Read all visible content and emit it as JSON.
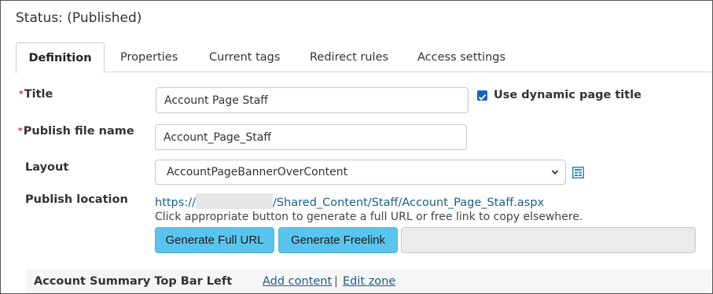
{
  "status": "Status: (Published)",
  "tabs": [
    {
      "label": "Definition",
      "active": true
    },
    {
      "label": "Properties"
    },
    {
      "label": "Current tags"
    },
    {
      "label": "Redirect rules"
    },
    {
      "label": "Access settings"
    }
  ],
  "required_marker": "*",
  "title_field": {
    "label": "Title",
    "value": "Account Page Staff"
  },
  "dynamic_title": {
    "label": "Use dynamic page title",
    "checked": true
  },
  "publish_file": {
    "label": "Publish file name",
    "value": "Account_Page_Staff"
  },
  "layout": {
    "label": "Layout",
    "selected": "AccountPageBannerOverContent",
    "icon": "layout-grid-icon"
  },
  "publish_location": {
    "label": "Publish location",
    "url_prefix": "https://",
    "url_path": "/Shared_Content/Staff/Account_Page_Staff.aspx",
    "hint": "Click appropriate button to generate a full URL or free link to copy elsewhere.",
    "generate_full_url": "Generate Full URL",
    "generate_freelink": "Generate Freelink",
    "link_output": ""
  },
  "zone": {
    "title": "Account Summary Top Bar Left",
    "add_content": "Add content",
    "separator": "|",
    "edit_zone": "Edit zone"
  },
  "colors": {
    "accent_button": "#5bc4ee",
    "link": "#1a5e8a",
    "checkbox": "#1565c0",
    "required": "#c0392b"
  }
}
